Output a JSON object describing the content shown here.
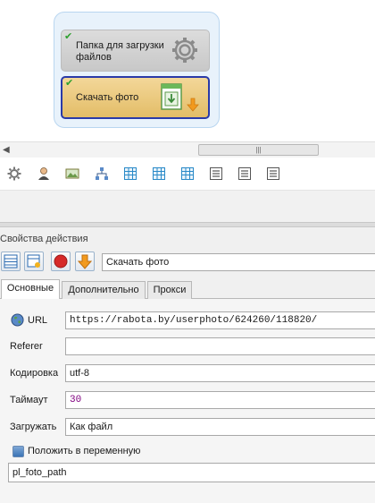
{
  "canvas": {
    "block1": {
      "label_line1": "Папка для загрузки",
      "label_line2": "файлов",
      "checkmark": "✔",
      "icon": "gear-icon"
    },
    "block2": {
      "label": "Скачать фото",
      "checkmark": "✔",
      "icon": "download-photo-icon"
    }
  },
  "scrollbar": {
    "left_arrow": "◀",
    "thumb_grip": "|||"
  },
  "toolbar": {
    "icons": [
      "gear-icon",
      "user-icon",
      "image-icon",
      "hierarchy-icon",
      "table-icon",
      "table-icon",
      "table-icon",
      "list-icon",
      "list-icon",
      "list-icon"
    ]
  },
  "properties": {
    "title": "Свойства действия",
    "action_name": "Скачать фото",
    "tabs": [
      {
        "label": "Основные",
        "active": true
      },
      {
        "label": "Дополнительно",
        "active": false
      },
      {
        "label": "Прокси",
        "active": false
      }
    ],
    "fields": {
      "url_label": "URL",
      "url_value": "https://rabota.by/userphoto/624260/118820/",
      "referer_label": "Referer",
      "referer_value": "",
      "encoding_label": "Кодировка",
      "encoding_value": "utf-8",
      "timeout_label": "Таймаут",
      "timeout_value": "30",
      "load_label": "Загружать",
      "load_value": "Как файл",
      "save_var_label": "Положить в переменную",
      "save_var_value": "pl_foto_path"
    }
  },
  "colors": {
    "accent_border": "#2a3aa8",
    "block_orange": "#e3bd67",
    "check_green": "#2ea02e",
    "timeout_purple": "#800080"
  }
}
